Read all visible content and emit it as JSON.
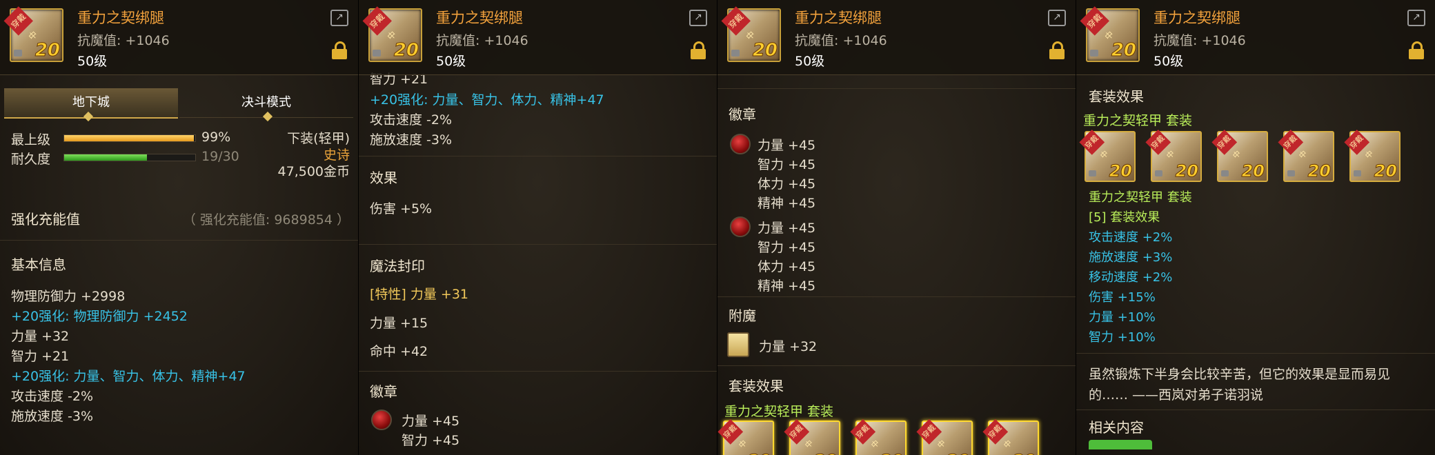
{
  "item": {
    "name": "重力之契绑腿",
    "resist": "抗魔值: +1046",
    "level": "50级",
    "badge_tag": "穿戴中",
    "badge_num": "20"
  },
  "tabs": [
    "地下城",
    "决斗模式"
  ],
  "stats": {
    "top_label": "最上级",
    "top_value": "99%",
    "top_fill": 0.99,
    "dur_label": "耐久度",
    "dur_value": "19/30",
    "dur_fill": 0.633,
    "slot": "下装(轻甲)",
    "rarity": "史诗",
    "price": "47,500金币"
  },
  "charge": {
    "label": "强化充能值",
    "value": "（ 强化充能值: 9689854 ）"
  },
  "basic": {
    "title": "基本信息",
    "lines": [
      "物理防御力 +2998",
      "+20强化: 物理防御力 +2452",
      "力量 +32",
      "智力 +21",
      "+20强化: 力量、智力、体力、精神+47",
      "攻击速度 -2%",
      "施放速度 -3%"
    ]
  },
  "p2": {
    "cut": "智力 +21",
    "enhance": "+20强化: 力量、智力、体力、精神+47",
    "atk": "攻击速度 -2%",
    "cast": "施放速度 -3%",
    "effect_title": "效果",
    "effect": "伤害 +5%",
    "seal_title": "魔法封印",
    "seal1": "[特性] 力量 +31",
    "seal2": "力量 +15",
    "seal3": "命中 +42",
    "emblem_title": "徽章",
    "e1": "力量 +45",
    "e2": "智力 +45"
  },
  "p3": {
    "emblem_title": "徽章",
    "group": [
      "力量 +45",
      "智力 +45",
      "体力 +45",
      "精神 +45"
    ],
    "enchant_title": "附魔",
    "enchant": "力量 +32",
    "set_title": "套装效果",
    "set_name": "重力之契轻甲 套装"
  },
  "p4": {
    "set_title": "套装效果",
    "set_name": "重力之契轻甲 套装",
    "set_name2": "重力之契轻甲 套装",
    "set_count": "[5] 套装效果",
    "bonuses": [
      "攻击速度 +2%",
      "施放速度 +3%",
      "移动速度 +2%",
      "伤害 +15%",
      "力量 +10%",
      "智力 +10%"
    ],
    "flavor1": "虽然锻炼下半身会比较辛苦，但它的效果是显而易见",
    "flavor2": "的…… ——西岚对弟子诺羽说",
    "related": "相关内容"
  },
  "colors": {
    "name": "#f3a23c",
    "cyan": "#38c2e6",
    "green": "#b9ee5a",
    "gold": "#e2b130",
    "rarity": "#e8a23a"
  }
}
